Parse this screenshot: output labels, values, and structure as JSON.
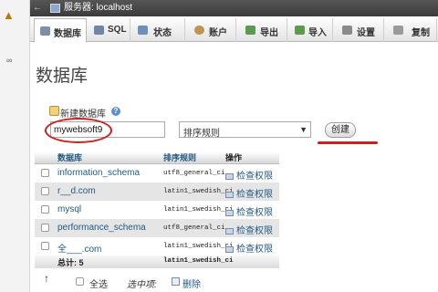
{
  "server_bar": {
    "label": "服务器: localhost"
  },
  "tabs": [
    {
      "label": "数据库",
      "icon": "database-icon",
      "active": true
    },
    {
      "label": "SQL",
      "icon": "sql-icon"
    },
    {
      "label": "状态",
      "icon": "status-icon"
    },
    {
      "label": "账户",
      "icon": "accounts-icon"
    },
    {
      "label": "导出",
      "icon": "export-icon"
    },
    {
      "label": "导入",
      "icon": "import-icon"
    },
    {
      "label": "设置",
      "icon": "settings-icon"
    },
    {
      "label": "复制",
      "icon": "replication-icon"
    }
  ],
  "page_title": "数据库",
  "create_db": {
    "label": "新建数据库",
    "name_value": "mywebsoft9",
    "collation_placeholder": "排序规则",
    "create_button": "创建"
  },
  "table": {
    "headers": {
      "database": "数据库",
      "collation": "排序规则",
      "action": "操作"
    },
    "rows": [
      {
        "name": "information_schema",
        "collation": "utf8_general_ci",
        "action": "检查权限"
      },
      {
        "name": "r__d.com",
        "collation": "latin1_swedish_ci",
        "action": "检查权限"
      },
      {
        "name": "mysql",
        "collation": "latin1_swedish_ci",
        "action": "检查权限"
      },
      {
        "name": "performance_schema",
        "collation": "utf8_general_ci",
        "action": "检查权限"
      },
      {
        "name": "全___.com",
        "collation": "latin1_swedish_ci",
        "action": "检查权限"
      }
    ],
    "total_label": "总计: 5",
    "total_collation": "latin1_swedish_ci"
  },
  "footer": {
    "select_all": "全选",
    "with_selected": "选中项:",
    "delete": "删除"
  },
  "colors": {
    "link_blue": "#235a81",
    "annotation_red": "#d41c1c",
    "top_bar": "#3b3b3b"
  }
}
